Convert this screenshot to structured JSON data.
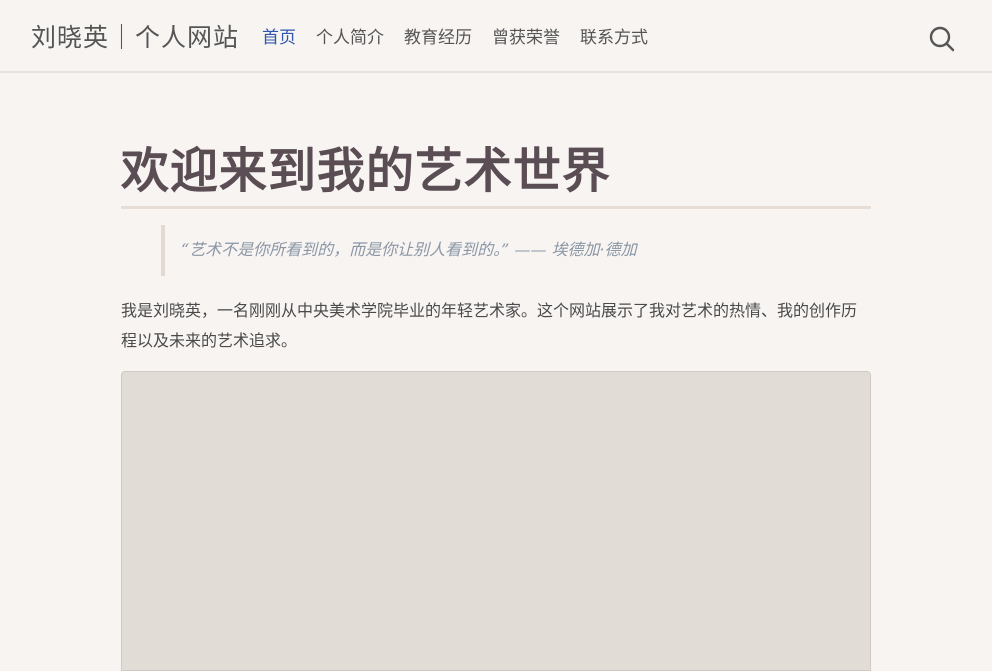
{
  "header": {
    "site_title": "刘晓英｜个人网站",
    "nav": [
      {
        "label": "首页",
        "active": true
      },
      {
        "label": "个人简介",
        "active": false
      },
      {
        "label": "教育经历",
        "active": false
      },
      {
        "label": "曾获荣誉",
        "active": false
      },
      {
        "label": "联系方式",
        "active": false
      }
    ],
    "search_icon": "search-icon"
  },
  "main": {
    "title": "欢迎来到我的艺术世界",
    "quote": "“艺术不是你所看到的，而是你让别人看到的。” —— 埃德加·德加",
    "intro": "我是刘晓英，一名刚刚从中央美术学院毕业的年轻艺术家。这个网站展示了我对艺术的热情、我的创作历程以及未来的艺术追求。"
  },
  "colors": {
    "background": "#f7f4f2",
    "nav_active": "#2f56b0",
    "title": "#5a4e54",
    "quote": "#8b96a5"
  }
}
